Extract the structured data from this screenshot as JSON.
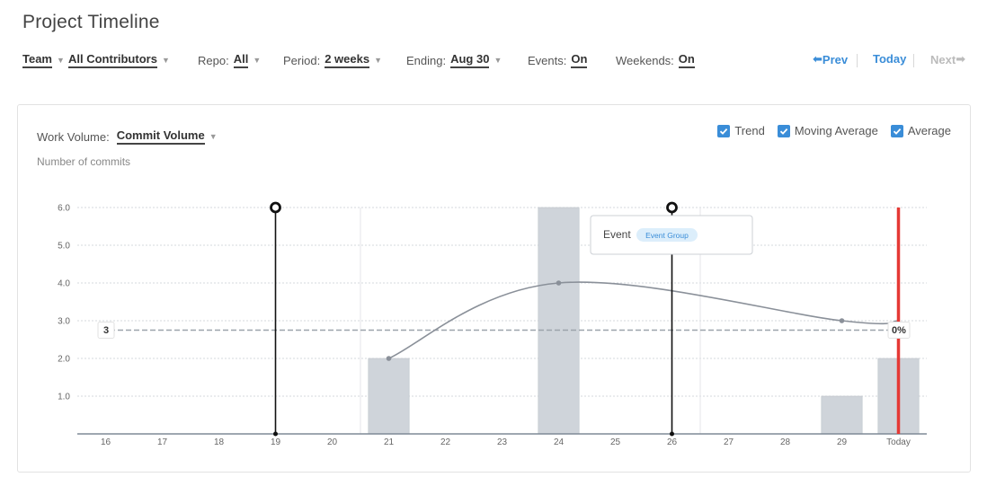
{
  "page": {
    "title": "Project Timeline"
  },
  "toolbar": {
    "team": "Team",
    "contributors": "All Contributors",
    "repo_label": "Repo:",
    "repo_value": "All",
    "period_label": "Period:",
    "period_value": "2 weeks",
    "ending_label": "Ending:",
    "ending_value": "Aug 30",
    "events_label": "Events:",
    "events_value": "On",
    "weekends_label": "Weekends:",
    "weekends_value": "On"
  },
  "nav": {
    "prev": "Prev",
    "today": "Today",
    "next": "Next"
  },
  "card": {
    "work_volume_label": "Work Volume:",
    "work_volume_value": "Commit Volume",
    "subtitle": "Number of commits",
    "checkboxes": [
      {
        "label": "Trend",
        "checked": true
      },
      {
        "label": "Moving Average",
        "checked": true
      },
      {
        "label": "Average",
        "checked": true
      }
    ]
  },
  "icons": {
    "prev": "arrow-left-icon",
    "next": "arrow-right-icon",
    "caret": "caret-down-icon",
    "check": "check-icon"
  },
  "colors": {
    "accent": "#3a8dd8",
    "today_line": "#e53935",
    "bar": "#cfd4da",
    "trend": "#8a9099"
  },
  "chart_data": {
    "type": "bar",
    "categories": [
      "16",
      "17",
      "18",
      "19",
      "20",
      "21",
      "22",
      "23",
      "24",
      "25",
      "26",
      "27",
      "28",
      "29",
      "Today"
    ],
    "values": [
      0,
      0,
      0,
      0,
      0,
      2,
      0,
      0,
      6,
      0,
      0,
      0,
      0,
      1,
      2
    ],
    "ylim": [
      0,
      6
    ],
    "yticks": [
      "1.0",
      "2.0",
      "3.0",
      "4.0",
      "5.0",
      "6.0"
    ],
    "trend_points": [
      {
        "x": "21",
        "y": 2
      },
      {
        "x": "24",
        "y": 4
      },
      {
        "x": "29",
        "y": 3
      },
      {
        "x": "Today",
        "y": 3
      }
    ],
    "average": 2.75,
    "average_left_label": "3",
    "average_right_label": "0%",
    "events": [
      {
        "x": "19",
        "label": ""
      },
      {
        "x": "26",
        "label": "Event",
        "tag": "Event Group"
      }
    ],
    "weekend_dividers_after": [
      "20",
      "26"
    ],
    "today_marker": "Today",
    "grid": true
  }
}
